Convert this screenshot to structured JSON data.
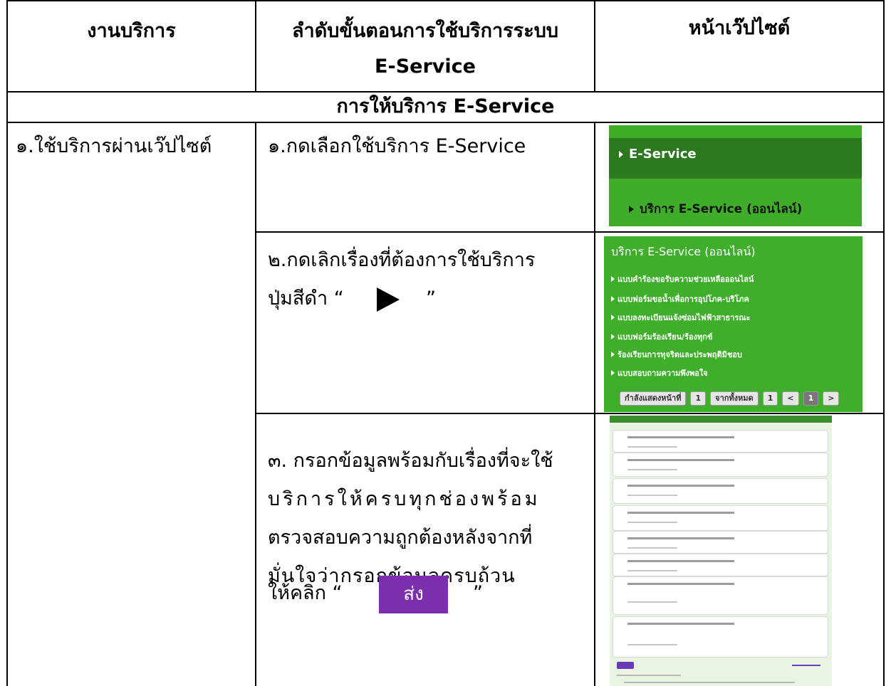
{
  "header": {
    "col1": "งานบริการ",
    "col2_line1": "ลำดับขั้นตอนการใช้บริการระบบ",
    "col2_line2": "E-Service",
    "col3": "หน้าเว๊ปไซต์"
  },
  "section_title": "การให้บริการ E-Service",
  "service_name": "๑.ใช้บริการผ่านเว๊ปไซต์",
  "steps": {
    "step1": "๑.กดเลือกใช้บริการ E-Service",
    "step2_line1": "๒.กดเลิกเรื่องที่ต้องการใช้บริการ",
    "step2_line2_prefix": "ปุ่มสีดำ  “",
    "step2_line2_suffix": "”",
    "step3_lines": [
      "๓. กรอกข้อมูลพร้อมกับเรื่องที่จะใช้",
      "บริการให้ครบทุกช่องพร้อม",
      "ตรวจสอบความถูกต้องหลังจากที่",
      "มั่นใจว่ากรอกข้อมูลครบถ้วน"
    ],
    "step3_last_prefix": "ให้คลิก  “",
    "step3_last_suffix": "”",
    "send_button": "ส่ง"
  },
  "screenshot_menu": {
    "title": "E-Service",
    "subitem": "บริการ E-Service (ออนไลน์)"
  },
  "screenshot_list": {
    "title": "บริการ E-Service (ออนไลน์)",
    "items": [
      "แบบคำร้องขอรับความช่วยเหลือออนไลน์",
      "แบบฟอร์มขอน้ำเพื่อการอุปโภค-บริโภค",
      "แบบลงทะเบียนแจ้งซ่อมไฟฟ้าสาธารณะ",
      "แบบฟอร์มร้องเรียน/ร้องทุกข์",
      "ร้องเรียนการทุจริตและประพฤติมิชอบ",
      "แบบสอบถามความพึงพอใจ"
    ],
    "pager": {
      "showing_label": "กำลังแสดงหน้าที่",
      "page": "1",
      "of_label": "จากทั้งหมด",
      "total": "1",
      "prev": "<",
      "current": "1",
      "next": ">"
    }
  },
  "colors": {
    "menu_green": "#3fad2a",
    "menu_dark": "#2c781f",
    "send_purple": "#7b2fad"
  }
}
